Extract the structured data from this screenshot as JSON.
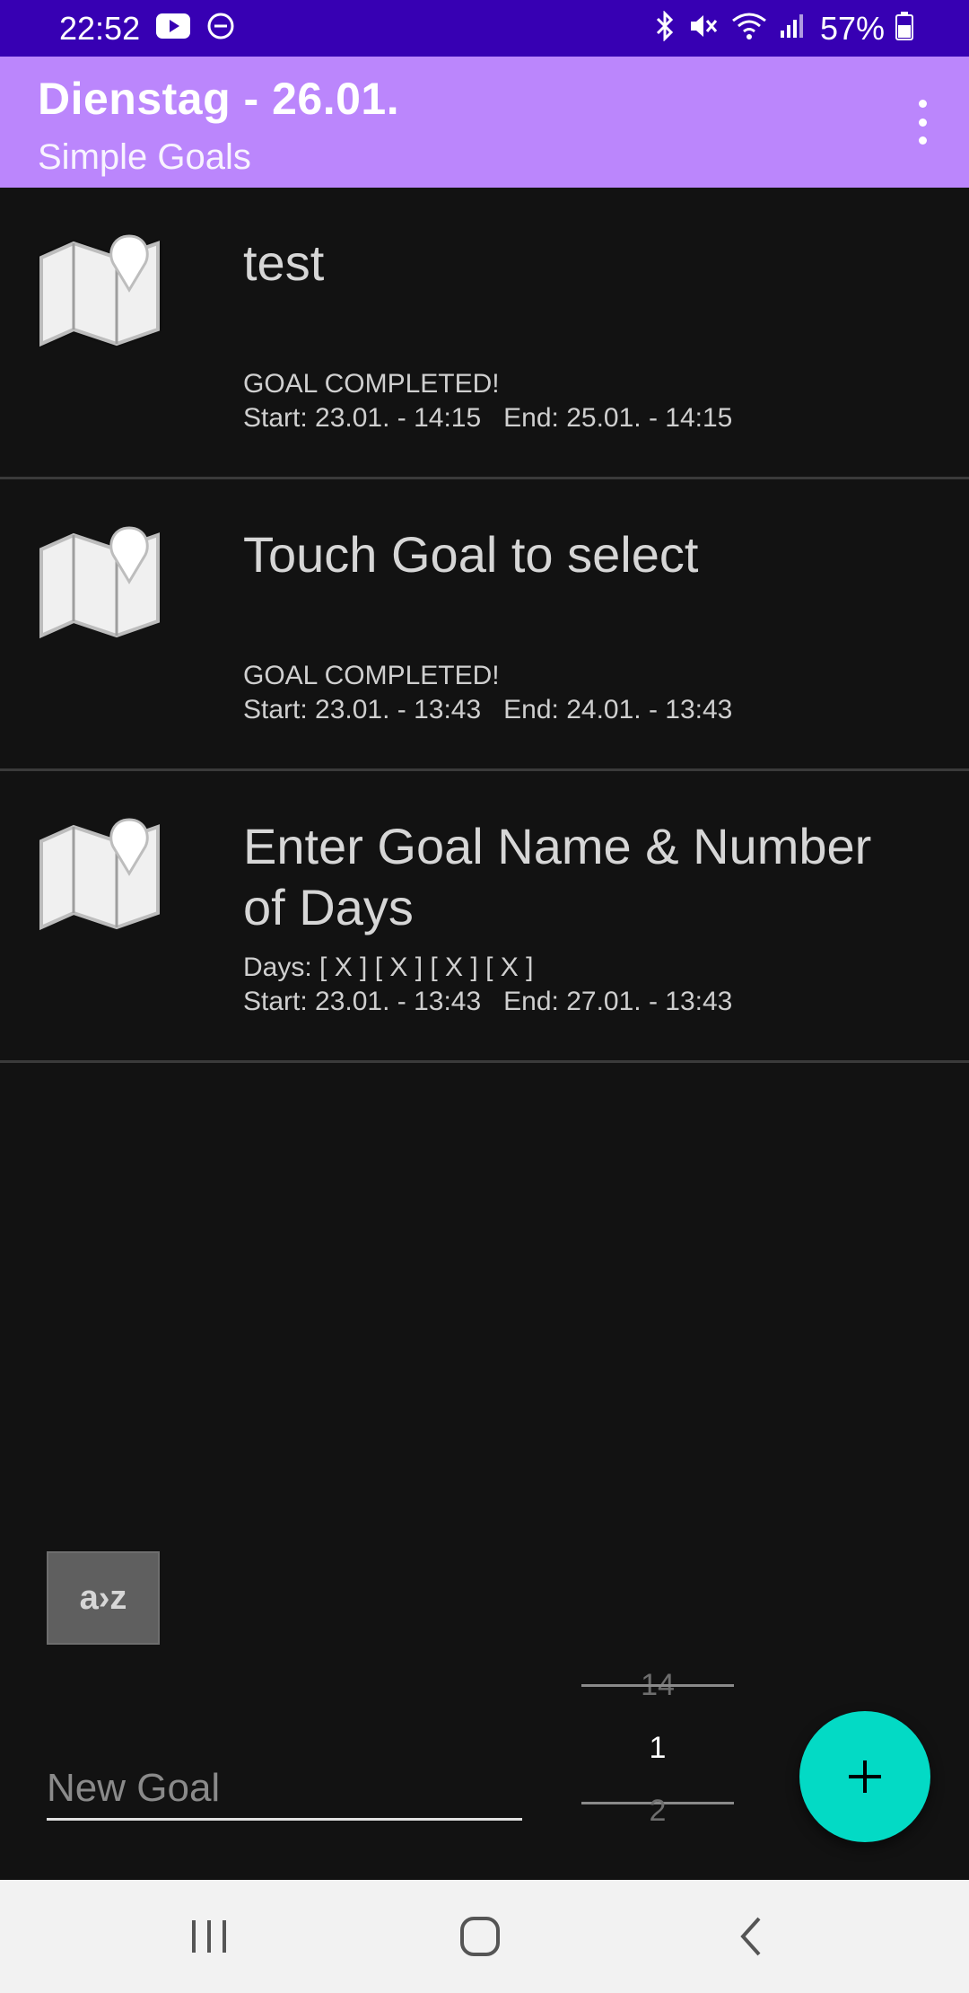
{
  "status_bar": {
    "time": "22:52",
    "battery": "57%",
    "icons": [
      "youtube-icon",
      "do-not-disturb-icon",
      "bluetooth-icon",
      "mute-icon",
      "wifi-icon",
      "signal-icon",
      "battery-icon"
    ]
  },
  "app_bar": {
    "title": "Dienstag - 26.01.",
    "subtitle": "Simple Goals",
    "menu_icon": "more-vert-icon"
  },
  "goals": [
    {
      "title": "test",
      "status": "GOAL COMPLETED!",
      "dates": "Start: 23.01. - 14:15   End: 25.01. - 14:15",
      "icon": "map-pin-icon"
    },
    {
      "title": "Touch Goal to select",
      "status": "GOAL COMPLETED!",
      "dates": "Start: 23.01. - 13:43   End: 24.01. - 13:43",
      "icon": "map-pin-icon"
    },
    {
      "title": "Enter Goal Name & Number of Days",
      "status": "Days: [ X ] [ X ] [ X ] [ X ]",
      "dates": "Start: 23.01. - 13:43   End: 27.01. - 13:43",
      "icon": "map-pin-icon"
    }
  ],
  "sort_button": {
    "label": "a›z"
  },
  "new_goal": {
    "placeholder": "New Goal",
    "value": ""
  },
  "day_picker": {
    "prev": "14",
    "current": "1",
    "next": "2"
  },
  "fab": {
    "icon": "plus-icon"
  },
  "nav_bar": {
    "icons": [
      "recents-icon",
      "home-icon",
      "back-icon"
    ]
  },
  "colors": {
    "status_bar": "#3700b3",
    "app_bar": "#bb86fc",
    "background": "#121212",
    "fab": "#03dac5"
  }
}
